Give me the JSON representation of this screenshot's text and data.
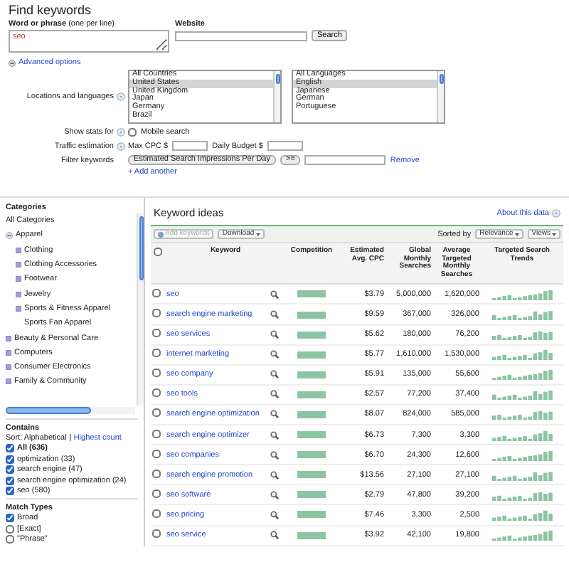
{
  "form": {
    "title": "Find keywords",
    "phrase_label": "**Word or phrase** (one per line)",
    "phrase_value": "seo",
    "website_label": "Website",
    "search_button": "Search",
    "advanced_options": "Advanced options",
    "locations_label": "Locations and languages",
    "locations": [
      {
        "label": "All Countries",
        "selected": false
      },
      {
        "label": "United States",
        "selected": true
      },
      {
        "label": "United Kingdom",
        "selected": false
      },
      {
        "label": "Japan",
        "selected": false
      },
      {
        "label": "Germany",
        "selected": false
      },
      {
        "label": "Brazil",
        "selected": false
      }
    ],
    "languages": [
      {
        "label": "All Languages",
        "selected": false
      },
      {
        "label": "English",
        "selected": true
      },
      {
        "label": "Japanese",
        "selected": false
      },
      {
        "label": "German",
        "selected": false
      },
      {
        "label": "Portuguese",
        "selected": false
      }
    ],
    "show_stats_label": "Show stats for",
    "mobile_search": {
      "label": "Mobile search",
      "checked": false
    },
    "traffic_label": "Traffic estimation",
    "max_cpc_label": "Max CPC $",
    "daily_budget_label": "Daily Budget $",
    "filter_label": "Filter keywords",
    "filter_select": "Estimated Search Impressions Per Day",
    "operator_select": ">=",
    "remove_link": "Remove",
    "add_another": "+ Add another"
  },
  "sidebar": {
    "categories_title": "Categories",
    "categories": [
      {
        "label": "All Categories"
      },
      {
        "label": "Apparel",
        "expanded": true,
        "children": [
          {
            "label": "Clothing",
            "expanded": false
          },
          {
            "label": "Clothing Accessories",
            "expanded": false
          },
          {
            "label": "Footwear",
            "expanded": false
          },
          {
            "label": "Jewelry",
            "expanded": false
          },
          {
            "label": "Sports & Fitness Apparel",
            "expanded": false
          },
          {
            "label": "Sports Fan Apparel"
          }
        ]
      },
      {
        "label": "Beauty & Personal Care",
        "expanded": false
      },
      {
        "label": "Computers",
        "expanded": false
      },
      {
        "label": "Consumer Electronics",
        "expanded": false
      },
      {
        "label": "Family & Community",
        "expanded": false
      }
    ],
    "contains_title": "Contains",
    "sort_label": "Sort: Alphabetical",
    "sort_link": "Highest count",
    "contains": [
      {
        "label": "All (636)",
        "checked": true
      },
      {
        "label": "optimization (33)",
        "checked": true
      },
      {
        "label": "search engine (47)",
        "checked": true
      },
      {
        "label": "search engine optimization (24)",
        "checked": true
      },
      {
        "label": "seo (580)",
        "checked": true
      }
    ],
    "match_title": "Match Types",
    "match_types": [
      {
        "label": "Broad",
        "checked": true
      },
      {
        "label": "[Exact]",
        "checked": false
      },
      {
        "label": "\"Phrase\"",
        "checked": false
      }
    ]
  },
  "ideas": {
    "title": "Keyword ideas",
    "about_link": "About this data",
    "add_keywords": {
      "label": "Add keywords",
      "disabled": true
    },
    "download": "Download",
    "sorted_by": "Sorted by",
    "sort_select": "Relevance",
    "views": "Views",
    "select_all": {
      "checked": false
    },
    "columns": [
      "Keyword",
      "Competition",
      "Estimated Avg. CPC",
      "Global Monthly Searches",
      "Average Targeted Monthly Searches",
      "Targeted Search Trends"
    ],
    "rows": [
      {
        "keyword": "seo",
        "selected": false,
        "competition": {
          "level": 1
        },
        "cpc": "$3.79",
        "global": "5,000,000",
        "targeted": "1,620,000"
      },
      {
        "keyword": "search engine marketing",
        "selected": false,
        "competition": {
          "level": 1
        },
        "cpc": "$9.59",
        "global": "367,000",
        "targeted": "326,000"
      },
      {
        "keyword": "seo services",
        "selected": false,
        "competition": {
          "level": 1
        },
        "cpc": "$5.62",
        "global": "180,000",
        "targeted": "76,200"
      },
      {
        "keyword": "internet marketing",
        "selected": false,
        "competition": {
          "level": 1
        },
        "cpc": "$5.77",
        "global": "1,610,000",
        "targeted": "1,530,000"
      },
      {
        "keyword": "seo company",
        "selected": false,
        "competition": {
          "level": 1
        },
        "cpc": "$5.91",
        "global": "135,000",
        "targeted": "55,600"
      },
      {
        "keyword": "seo tools",
        "selected": false,
        "competition": {
          "level": 1
        },
        "cpc": "$2.57",
        "global": "77,200",
        "targeted": "37,400"
      },
      {
        "keyword": "search engine optimization",
        "selected": false,
        "competition": {
          "level": 1
        },
        "cpc": "$8.07",
        "global": "824,000",
        "targeted": "585,000"
      },
      {
        "keyword": "search engine optimizer",
        "selected": false,
        "competition": {
          "level": 1
        },
        "cpc": "$6.73",
        "global": "7,300",
        "targeted": "3,300"
      },
      {
        "keyword": "seo companies",
        "selected": false,
        "competition": {
          "level": 1
        },
        "cpc": "$6.70",
        "global": "24,300",
        "targeted": "12,600"
      },
      {
        "keyword": "search engine promotion",
        "selected": false,
        "competition": {
          "level": 1
        },
        "cpc": "$13.56",
        "global": "27,100",
        "targeted": "27,100"
      },
      {
        "keyword": "seo software",
        "selected": false,
        "competition": {
          "level": 1
        },
        "cpc": "$2.79",
        "global": "47,800",
        "targeted": "39,200"
      },
      {
        "keyword": "seo pricing",
        "selected": false,
        "competition": {
          "level": 1
        },
        "cpc": "$7.46",
        "global": "3,300",
        "targeted": "2,500"
      },
      {
        "keyword": "seo service",
        "selected": false,
        "competition": {
          "level": 1
        },
        "cpc": "$3.92",
        "global": "42,100",
        "targeted": "19,800"
      }
    ]
  }
}
